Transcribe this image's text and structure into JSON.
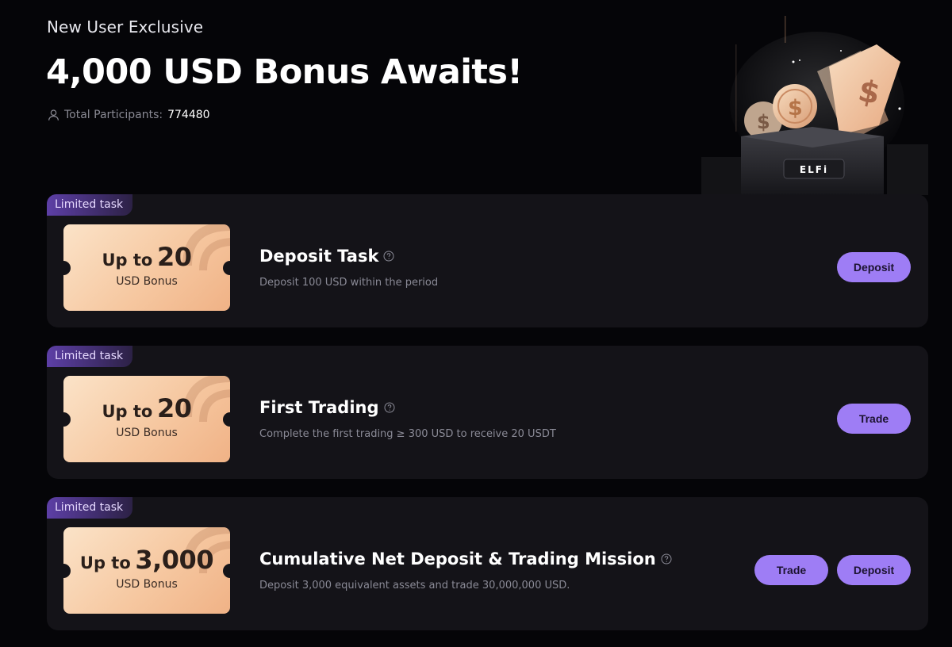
{
  "header": {
    "subtitle": "New User Exclusive",
    "headline": "4,000 USD Bonus Awaits!",
    "participants_label": "Total Participants:",
    "participants_count": "774480"
  },
  "hero": {
    "brand": "ELFi",
    "coin_symbol": "$"
  },
  "tasks": [
    {
      "badge": "Limited task",
      "ticket_prefix": "Up to",
      "ticket_amount": "20",
      "ticket_unit": "USD Bonus",
      "title": "Deposit Task",
      "description": "Deposit 100 USD within the period",
      "buttons": [
        "Deposit"
      ]
    },
    {
      "badge": "Limited task",
      "ticket_prefix": "Up to",
      "ticket_amount": "20",
      "ticket_unit": "USD Bonus",
      "title": "First Trading",
      "description": "Complete the first trading ≥ 300 USD to receive 20 USDT",
      "buttons": [
        "Trade"
      ]
    },
    {
      "badge": "Limited task",
      "ticket_prefix": "Up to",
      "ticket_amount": "3,000",
      "ticket_unit": "USD Bonus",
      "title": "Cumulative Net Deposit & Trading Mission",
      "description": "Deposit 3,000 equivalent assets and trade 30,000,000 USD.",
      "buttons": [
        "Trade",
        "Deposit"
      ]
    }
  ],
  "colors": {
    "background": "#050508",
    "card": "#141318",
    "accent_button": "#9e7df5",
    "badge": "#5d3fa6",
    "ticket": "#f6c8a1"
  }
}
